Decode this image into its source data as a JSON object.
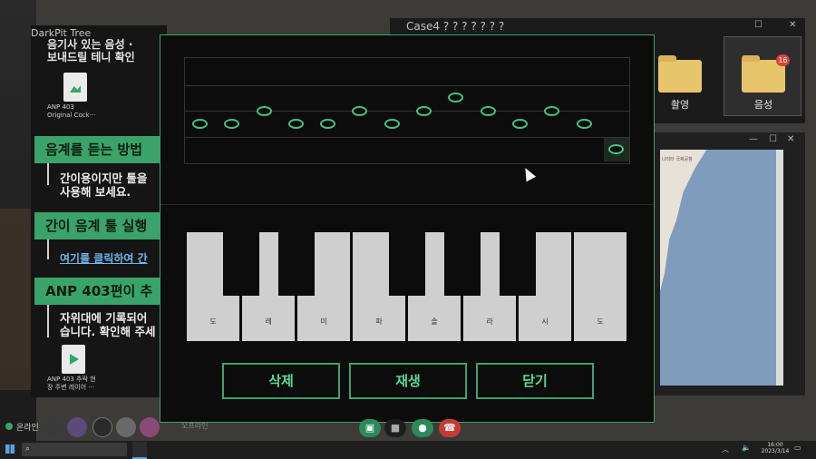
{
  "left_panel": {
    "app_title": "DarkPit Tree",
    "top_line": "음기사 있는 음성 ·",
    "top_line2": "보내드릴 테니 확인",
    "file1": {
      "name": "ANP 403\nOriginal Cock···"
    },
    "sections": [
      {
        "header": "음계를 듣는 방법",
        "line1": "간이용이지만 툴을",
        "line2": "사용해 보세요."
      },
      {
        "header": "간이 음계 툴 실행",
        "link": "여기를 클릭하여 간"
      },
      {
        "header": "ANP 403편이 추",
        "line1": "자위대에 기록되어",
        "line2": "습니다. 확인해 주세"
      }
    ],
    "file2": {
      "name": "ANP 403 추락 현\n장 주변 레이어 ···"
    }
  },
  "file_window": {
    "title": "Case4 ? ? ? ? ? ? ?",
    "folders": [
      {
        "label": "촬영"
      },
      {
        "label": "음성",
        "badge": "16"
      }
    ]
  },
  "map_window": {
    "label": "나리타 국제공항"
  },
  "modal": {
    "notes": [
      "도",
      "레",
      "미",
      "파",
      "솔",
      "라",
      "시",
      "도"
    ],
    "keys": [
      "도",
      "레",
      "미",
      "파",
      "솔",
      "라",
      "시",
      "도"
    ],
    "buttons": {
      "delete": "삭제",
      "play": "재생",
      "close": "닫기"
    }
  },
  "status": {
    "online": "온라인",
    "offline": "오프라인"
  },
  "taskbar": {
    "clock_time": "16:00",
    "clock_date": "2023/3/14"
  }
}
